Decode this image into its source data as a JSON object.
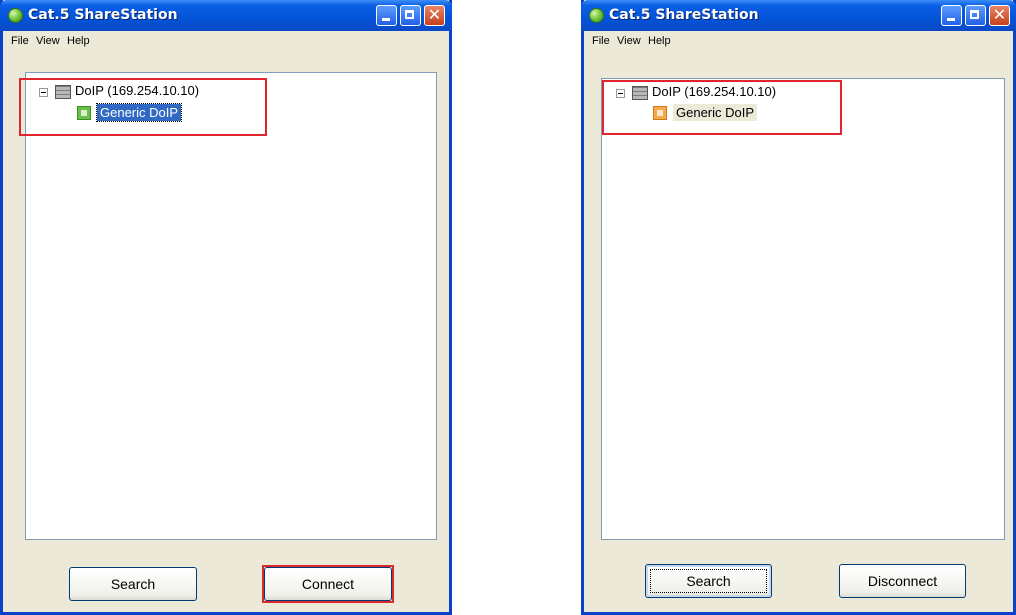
{
  "windows": [
    {
      "title": "Cat.5 ShareStation",
      "menu": [
        "File",
        "View",
        "Help"
      ],
      "tree": {
        "server_label": "DoIP (169.254.10.10)",
        "child_label": "Generic DoIP",
        "child_state": "selected"
      },
      "buttons": {
        "search": "Search",
        "action": "Connect"
      }
    },
    {
      "title": "Cat.5 ShareStation",
      "menu": [
        "File",
        "View",
        "Help"
      ],
      "tree": {
        "server_label": "DoIP (169.254.10.10)",
        "child_label": "Generic DoIP",
        "child_state": "connected"
      },
      "buttons": {
        "search": "Search",
        "action": "Disconnect"
      }
    }
  ],
  "colors": {
    "highlight_box": "#e0262c",
    "selected_bg": "#316ac5",
    "node_available": "#6cc04a",
    "node_connected": "#f5a94a"
  }
}
